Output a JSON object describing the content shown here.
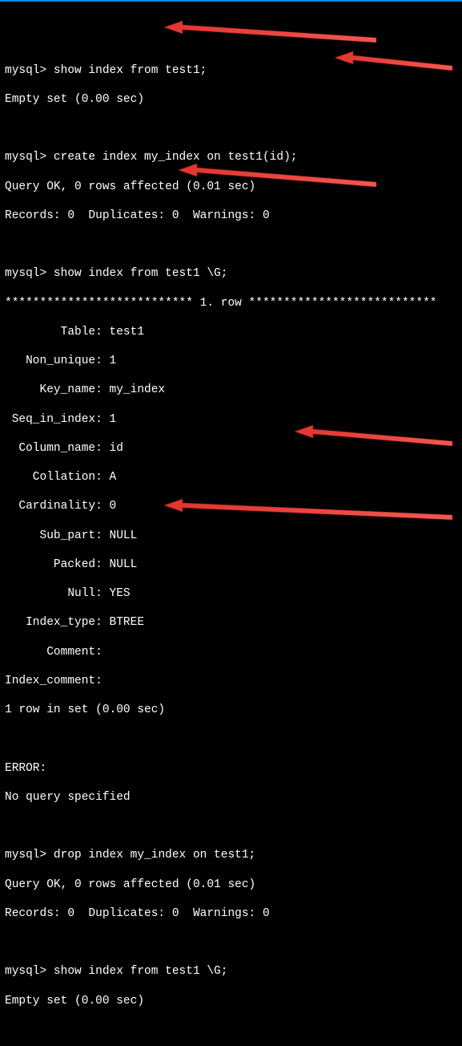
{
  "prompt": "mysql>",
  "cmd1": "show index from test1;",
  "out1": "Empty set (0.00 sec)",
  "cmd2": "create index my_index on test1(id);",
  "out2a": "Query OK, 0 rows affected (0.01 sec)",
  "out2b": "Records: 0  Duplicates: 0  Warnings: 0",
  "cmd3": "show index from test1 \\G;",
  "out3_header": "*************************** 1. row ***************************",
  "out3_rows": [
    "        Table: test1",
    "   Non_unique: 1",
    "     Key_name: my_index",
    " Seq_in_index: 1",
    "  Column_name: id",
    "    Collation: A",
    "  Cardinality: 0",
    "     Sub_part: NULL",
    "       Packed: NULL",
    "         Null: YES",
    "   Index_type: BTREE",
    "      Comment:",
    "Index_comment:"
  ],
  "out3_footer": "1 row in set (0.00 sec)",
  "err_label": "ERROR:",
  "err_msg": "No query specified",
  "cmd4": "drop index my_index on test1;",
  "out4a": "Query OK, 0 rows affected (0.01 sec)",
  "out4b": "Records: 0  Duplicates: 0  Warnings: 0",
  "cmd5": "show index from test1 \\G;",
  "out5": "Empty set (0.00 sec)",
  "arrow_color": "#e3332f",
  "arrow_stroke": "#8a1d1a"
}
